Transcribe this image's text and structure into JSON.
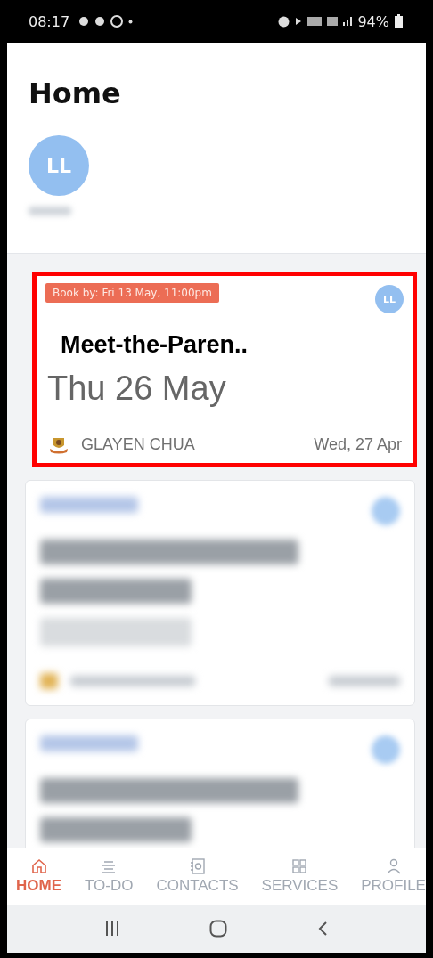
{
  "status_bar": {
    "time": "08:17",
    "battery": "94%"
  },
  "header": {
    "title": "Home",
    "avatar": "LL"
  },
  "cards": [
    {
      "kind": "event",
      "deadline": "Book by: Fri 13 May, 11:00pm",
      "avatar": "LL",
      "title": "Meet-the-Paren..",
      "date": "Thu 26 May",
      "sender": "GLAYEN CHUA",
      "sent": "Wed, 27 Apr",
      "highlighted": true
    },
    {
      "kind": "blurred"
    },
    {
      "kind": "blurred"
    }
  ],
  "tabs": [
    {
      "label": "HOME",
      "selected": true
    },
    {
      "label": "TO-DO",
      "selected": false
    },
    {
      "label": "CONTACTS",
      "selected": false
    },
    {
      "label": "SERVICES",
      "selected": false
    },
    {
      "label": "PROFILE",
      "selected": false
    }
  ]
}
